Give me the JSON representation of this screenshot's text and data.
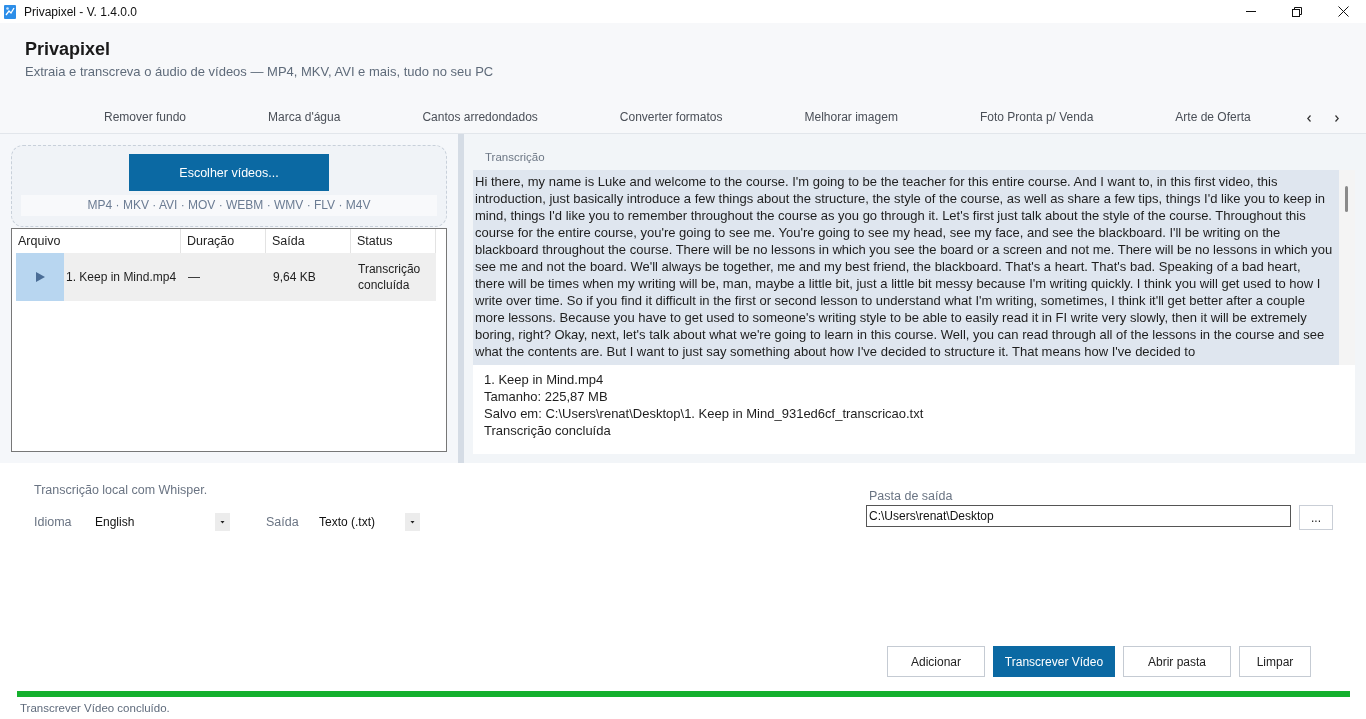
{
  "window": {
    "title": "Privapixel - V. 1.4.0.0"
  },
  "header": {
    "title": "Privapixel",
    "subtitle": "Extraia e transcreva o áudio de vídeos — MP4, MKV, AVI e mais, tudo no seu PC"
  },
  "tools_tabs": [
    {
      "label": "Remover fundo",
      "selected": false
    },
    {
      "label": "Marca d'água",
      "selected": false
    },
    {
      "label": "Cantos arredondados",
      "selected": false
    },
    {
      "label": "Converter formatos",
      "selected": false
    },
    {
      "label": "Melhorar imagem",
      "selected": false
    },
    {
      "label": "Foto Pronta p/ Venda",
      "selected": false
    },
    {
      "label": "Arte de Oferta",
      "selected": false
    }
  ],
  "drop_zone": {
    "button": "Escolher vídeos...",
    "formats": "MP4 · MKV · AVI · MOV · WEBM · WMV · FLV · M4V"
  },
  "file_table": {
    "columns": [
      "Arquivo",
      "Duração",
      "Saída",
      "Status"
    ],
    "rows": [
      {
        "file": "1. Keep in Mind.mp4",
        "duration": "—",
        "output": "9,64 KB",
        "status": "Transcrição concluída",
        "selected": true
      }
    ]
  },
  "transcript": {
    "label": "Transcrição",
    "text": "Hi there, my name is Luke and welcome to the course. I'm going to be the teacher for this entire course. And I want to, in this first video, this introduction, just basically introduce a few things about the structure, the style of the course, as well as share a few tips, things I'd like you to keep in mind, things I'd like you to remember throughout the course as you go through it. Let's first just talk about the style of the course. Throughout this course for the entire course, you're going to see me. You're going to see my head, see my face, and see the blackboard. I'll be writing on the blackboard throughout the course. There will be no lessons in which you see the board or a screen and not me. There will be no lessons in which you see me and not the board. We'll always be together, me and my best friend, the blackboard. That's a heart. That's bad. Speaking of a bad heart, there will be times when my writing will be, man, maybe a little bit, just a little bit messy because I'm writing quickly. I think you will get used to how I write over time. So if you find it difficult in the first or second lesson to understand what I'm writing, sometimes, I think it'll get better after a couple more lessons. Because you have to get used to someone's writing style to be able to easily read it in FI write very slowly, then it will be extremely boring, right? Okay, next, let's talk about what we're going to learn in this course. Well, you can read through all of the lessons in the course and see what the contents are. But I want to just say something about how I've decided to structure it. That means how I've decided to",
    "info_lines": [
      "1. Keep in Mind.mp4",
      "Tamanho: 225,87 MB",
      "Salvo em: C:\\Users\\renat\\Desktop\\1. Keep in Mind_931ed6cf_transcricao.txt",
      "Transcrição concluída"
    ]
  },
  "options": {
    "note": "Transcrição local com Whisper.",
    "language": {
      "label": "Idioma",
      "value": "English"
    },
    "output_format": {
      "label": "Saída",
      "value": "Texto (.txt)"
    },
    "output_folder": {
      "label": "Pasta de saída",
      "value": "C:\\Users\\renat\\Desktop",
      "browse": "..."
    }
  },
  "actions": [
    {
      "label": "Adicionar",
      "kind": "default"
    },
    {
      "label": "Transcrever Vídeo",
      "kind": "primary"
    },
    {
      "label": "Abrir pasta",
      "kind": "default"
    },
    {
      "label": "Limpar",
      "kind": "default"
    }
  ],
  "progress": {
    "level": 1
  },
  "status_bar": {
    "text": "Transcrever Vídeo concluído."
  }
}
